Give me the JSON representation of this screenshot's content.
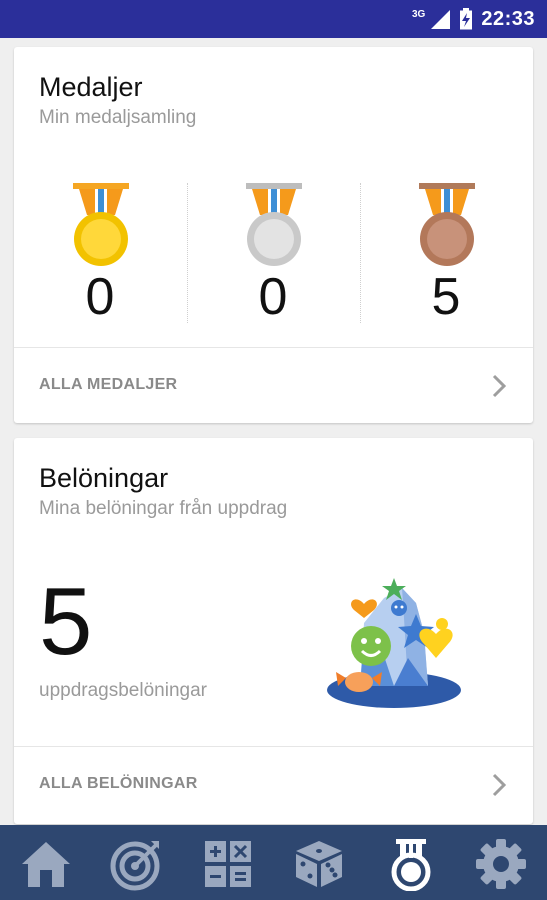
{
  "status_bar": {
    "network": "3G",
    "time": "22:33"
  },
  "medals": {
    "title": "Medaljer",
    "subtitle": "Min medaljsamling",
    "items": [
      {
        "type": "gold",
        "count": "0"
      },
      {
        "type": "silver",
        "count": "0"
      },
      {
        "type": "bronze",
        "count": "5"
      }
    ],
    "footer_label": "ALLA MEDALJER"
  },
  "rewards": {
    "title": "Belöningar",
    "subtitle": "Mina belöningar från uppdrag",
    "count": "5",
    "count_label": "uppdragsbelöningar",
    "footer_label": "ALLA BELÖNINGAR"
  },
  "bottom_nav": {
    "items": [
      {
        "icon": "home-icon"
      },
      {
        "icon": "target-icon"
      },
      {
        "icon": "calculator-icon"
      },
      {
        "icon": "dice-icon"
      },
      {
        "icon": "medal-icon",
        "active": true
      },
      {
        "icon": "settings-icon"
      }
    ]
  }
}
